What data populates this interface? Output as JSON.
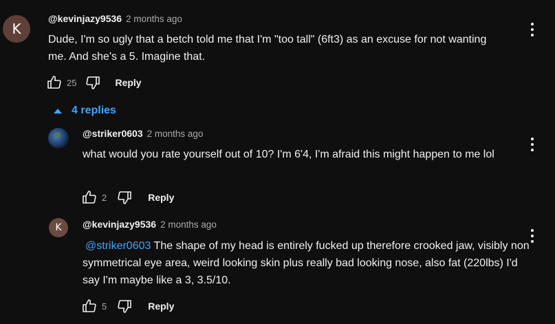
{
  "comment": {
    "avatar_letter": "K",
    "handle": "@kevinjazy9536",
    "time": "2 months ago",
    "text": "Dude, I'm so ugly that a betch told me that I'm \"too tall\" (6ft3) as an excuse for not wanting me.  And she's a 5. Imagine that.",
    "likes": "25",
    "reply_label": "Reply"
  },
  "replies_toggle": {
    "label": "4 replies"
  },
  "reply1": {
    "handle": "@striker0603",
    "time": "2 months ago",
    "text": "what would you rate yourself out of 10? I'm 6'4, I'm afraid this might happen to me lol",
    "likes": "2",
    "reply_label": "Reply"
  },
  "reply2": {
    "avatar_letter": "K",
    "handle": "@kevinjazy9536",
    "time": "2 months ago",
    "mention": "@striker0603",
    "text": "The shape of my head is entirely fucked up therefore crooked jaw, visibly non symmetrical eye area, weird looking skin plus really bad looking nose, also fat (220lbs)  I'd say I'm maybe like a 3, 3.5/10.",
    "likes": "5",
    "reply_label": "Reply"
  },
  "colors": {
    "background": "#0f0f0f",
    "link": "#3ea6ff",
    "muted": "#aaaaaa",
    "text": "#f1f1f1"
  }
}
